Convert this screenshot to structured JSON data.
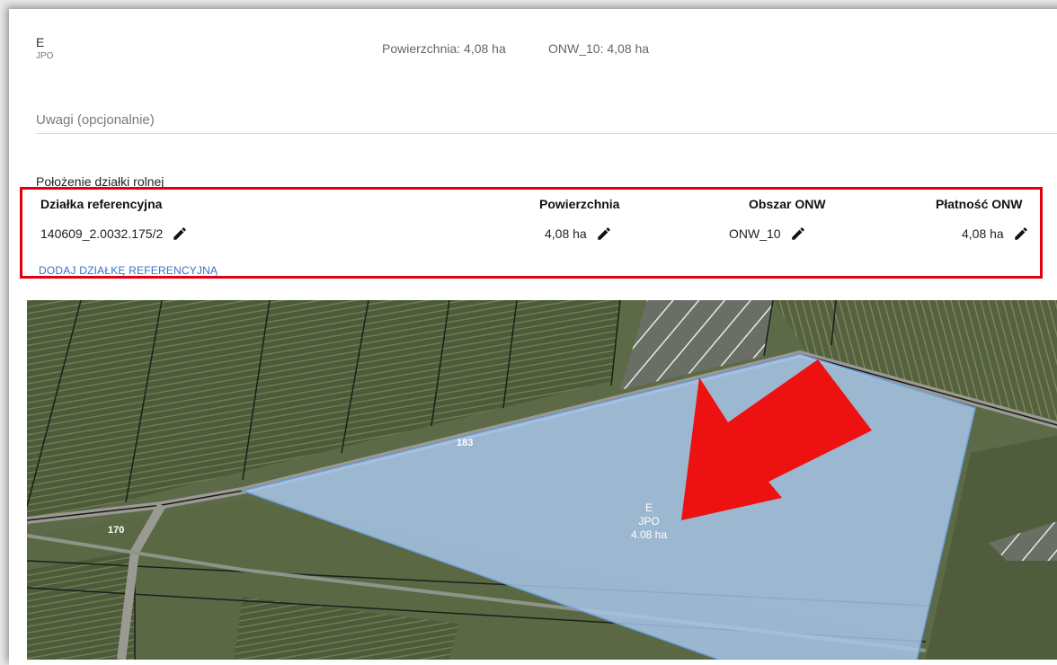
{
  "header": {
    "parcel_code": "E",
    "parcel_type": "JPO",
    "area_text": "Powierzchnia: 4,08 ha",
    "onw_text": "ONW_10: 4,08 ha"
  },
  "notes": {
    "placeholder": "Uwagi (opcjonalnie)"
  },
  "location": {
    "title": "Położenie działki rolnej",
    "columns": [
      "Działka referencyjna",
      "Powierzchnia",
      "Obszar ONW",
      "Płatność ONW"
    ],
    "row": {
      "reference_parcel": "140609_2.0032.175/2",
      "area": "4,08 ha",
      "onw_area": "ONW_10",
      "onw_payment": "4,08 ha"
    },
    "add_link": "DODAJ DZIAŁKĘ REFERENCYJNĄ"
  },
  "map": {
    "parcel_label": [
      "E",
      "JPO",
      "4.08 ha"
    ],
    "road_labels": [
      "183",
      "170"
    ],
    "highlight_color": "#e1000f",
    "parcel_fill": "#a9c8ee",
    "icons": [
      "edit-pencil-icon",
      "arrow-pointer-icon"
    ]
  }
}
